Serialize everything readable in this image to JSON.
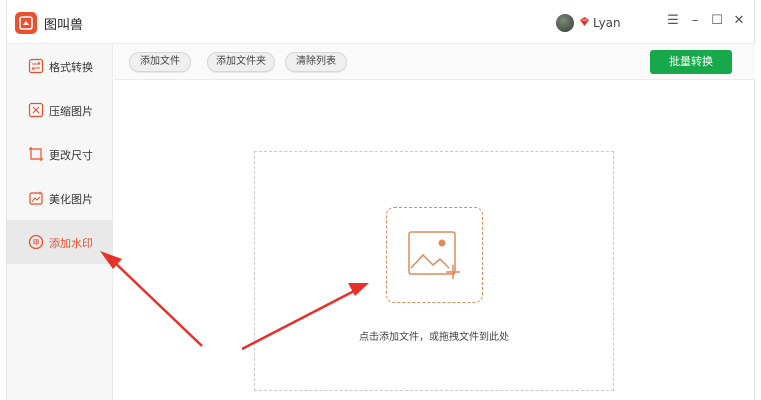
{
  "app": {
    "title": "图叫兽"
  },
  "user": {
    "name": "Lyan"
  },
  "window_controls": {
    "menu": "☰",
    "minimize": "–",
    "maximize": "☐",
    "close": "✕"
  },
  "sidebar": {
    "items": [
      {
        "label": "格式转换",
        "icon": "format-convert-icon"
      },
      {
        "label": "压缩图片",
        "icon": "compress-image-icon"
      },
      {
        "label": "更改尺寸",
        "icon": "resize-icon"
      },
      {
        "label": "美化图片",
        "icon": "beautify-image-icon"
      },
      {
        "label": "添加水印",
        "icon": "watermark-icon",
        "active": true
      }
    ]
  },
  "toolbar": {
    "add_file": "添加文件",
    "add_folder": "添加文件夹",
    "clear_list": "清除列表",
    "batch_convert": "批量转换"
  },
  "dropzone": {
    "hint": "点击添加文件，或拖拽文件到此处"
  },
  "colors": {
    "accent": "#e8502e",
    "primary_button": "#16a84a",
    "arrow": "#e8302a"
  }
}
